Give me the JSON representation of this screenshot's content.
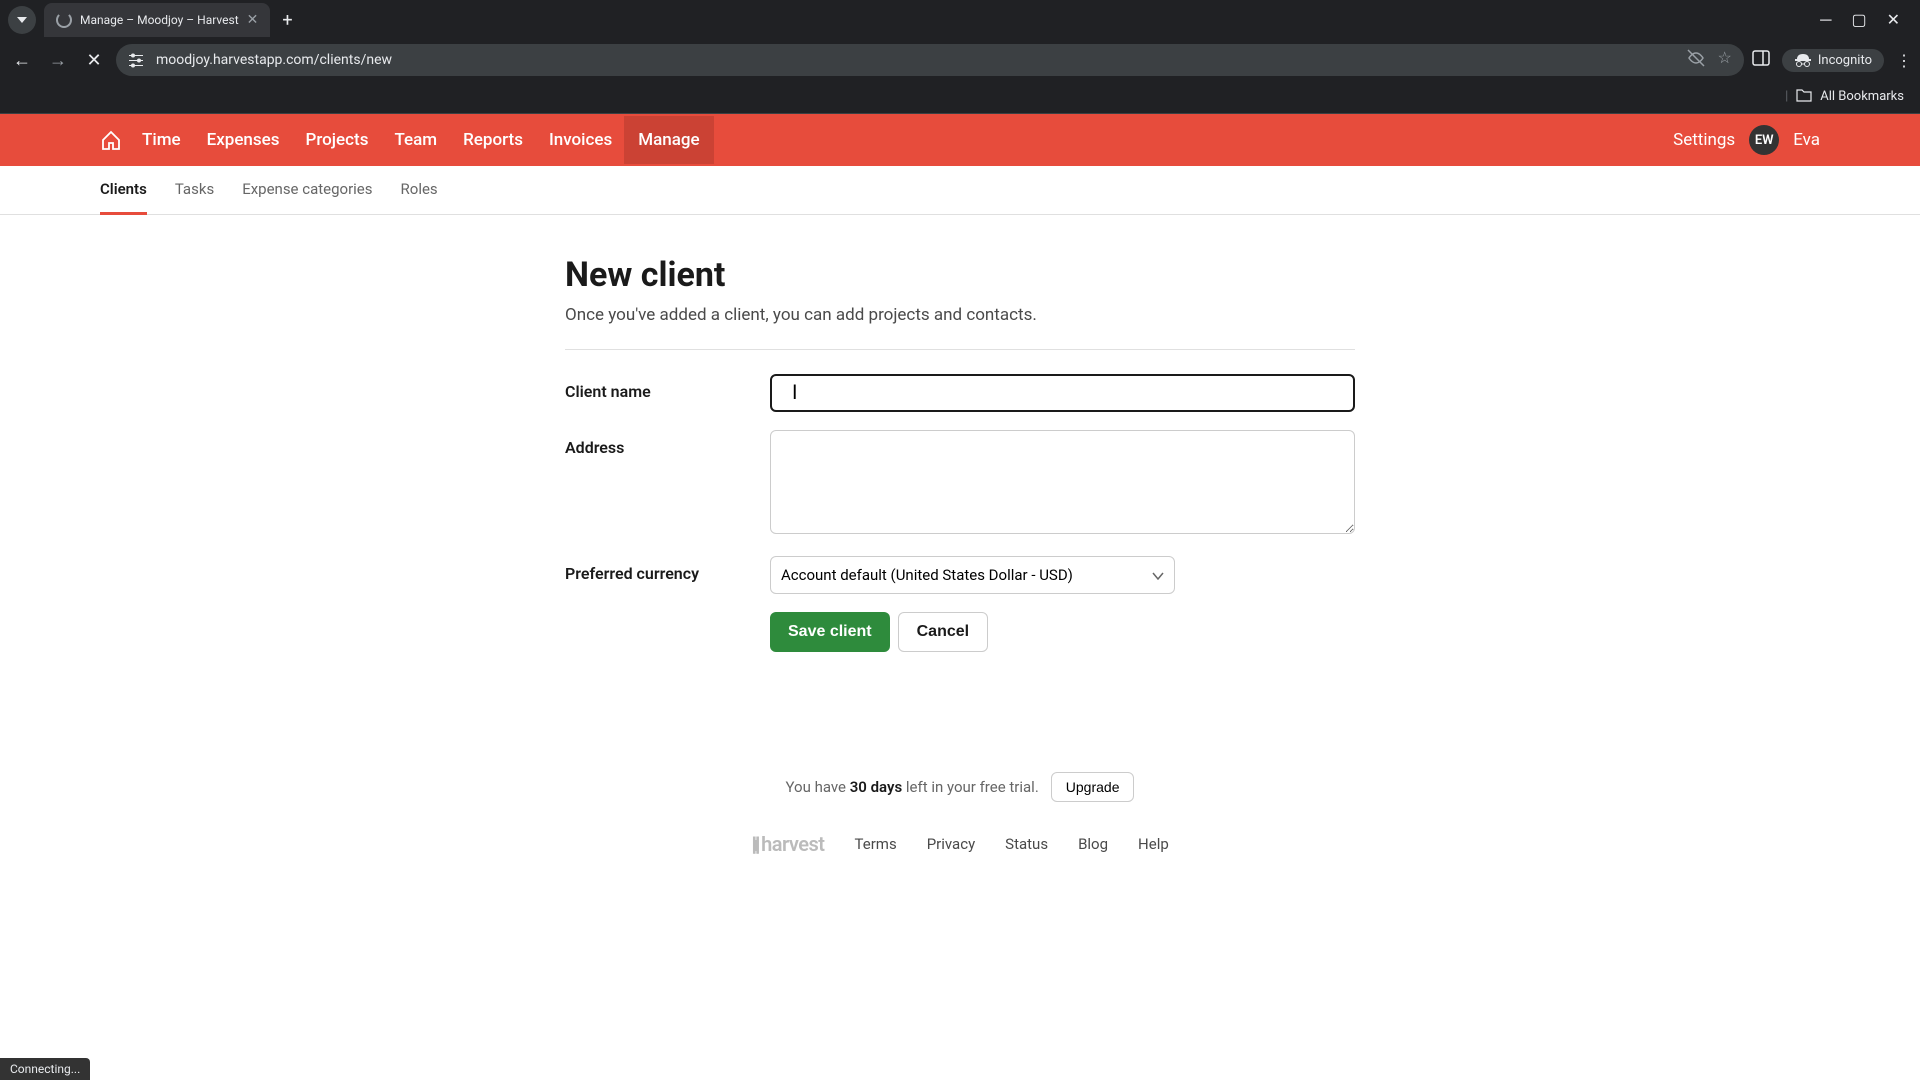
{
  "browser": {
    "tab_title": "Manage – Moodjoy – Harvest",
    "url": "moodjoy.harvestapp.com/clients/new",
    "incognito_label": "Incognito",
    "all_bookmarks": "All Bookmarks",
    "status": "Connecting..."
  },
  "header": {
    "nav": [
      "Time",
      "Expenses",
      "Projects",
      "Team",
      "Reports",
      "Invoices",
      "Manage"
    ],
    "active_nav": "Manage",
    "settings": "Settings",
    "user_initials": "EW",
    "user_name": "Eva"
  },
  "subnav": {
    "items": [
      "Clients",
      "Tasks",
      "Expense categories",
      "Roles"
    ],
    "active": "Clients"
  },
  "page": {
    "title": "New client",
    "subtitle": "Once you've added a client, you can add projects and contacts."
  },
  "form": {
    "client_name_label": "Client name",
    "client_name_value": "",
    "address_label": "Address",
    "address_value": "",
    "currency_label": "Preferred currency",
    "currency_value": "Account default (United States Dollar - USD)",
    "save_label": "Save client",
    "cancel_label": "Cancel"
  },
  "footer": {
    "trial_prefix": "You have ",
    "trial_days": "30 days",
    "trial_suffix": " left in your free trial.",
    "upgrade_label": "Upgrade",
    "logo": "harvest",
    "links": [
      "Terms",
      "Privacy",
      "Status",
      "Blog",
      "Help"
    ]
  }
}
